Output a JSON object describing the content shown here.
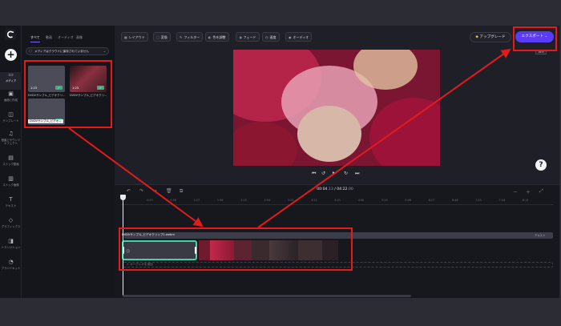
{
  "rail": {
    "items": [
      {
        "label": "メディア",
        "icon": "folder-icon"
      },
      {
        "label": "画面と作成",
        "icon": "camera-icon"
      },
      {
        "label": "テンプレート",
        "icon": "template-icon"
      },
      {
        "label": "音楽とサウンドエフェクト",
        "icon": "music-icon"
      },
      {
        "label": "ストック動画",
        "icon": "film-icon"
      },
      {
        "label": "ストック画像",
        "icon": "image-icon"
      },
      {
        "label": "テキスト",
        "icon": "text-icon"
      },
      {
        "label": "グラフィックス",
        "icon": "shapes-icon"
      },
      {
        "label": "トランジション",
        "icon": "transition-icon"
      },
      {
        "label": "ブランドキット",
        "icon": "brand-icon"
      }
    ]
  },
  "media": {
    "tabs": [
      "すべて",
      "動画",
      "オーディオ",
      "画像"
    ],
    "storage_button": "メディアはクラウドに保存されていません",
    "items": [
      {
        "duration": "1:23",
        "caption": "DVDVサンプル_ビデオクリ..."
      },
      {
        "duration": "1:23",
        "caption": "DVDVサンプル_ビデオクリ..."
      },
      {
        "duration": "1:34",
        "caption": "DVDVサンプル_ビデオ..."
      }
    ]
  },
  "toolbar": {
    "tools": [
      {
        "label": "レイアウト",
        "icon": "layout-icon"
      },
      {
        "label": "変換",
        "icon": "transform-icon"
      },
      {
        "label": "フィルター",
        "icon": "filter-icon"
      },
      {
        "label": "色を調整",
        "icon": "color-icon"
      },
      {
        "label": "フェード",
        "icon": "fade-icon"
      },
      {
        "label": "速度",
        "icon": "speed-icon"
      },
      {
        "label": "オーディオ",
        "icon": "audio-icon"
      }
    ],
    "upgrade": "アップグレード",
    "export": "エクスポート",
    "ratio": "16:9"
  },
  "timeline": {
    "current": "00:04",
    "current_frac": ".13",
    "total": "04:22",
    "total_frac": ".00",
    "ticks": [
      "0:29",
      "0:58",
      "1:27",
      "1:56",
      "2:25",
      "2:54",
      "3:23",
      "3:52",
      "4:21",
      "4:50",
      "5:19",
      "5:48",
      "6:17",
      "6:46",
      "7:15",
      "7:44",
      "8:13"
    ],
    "text_clip": "DVDVサンプル_ビデオクリップ1.webm",
    "text_track_end": "テキスト",
    "audio_placeholder": "+ オーディオを追加"
  },
  "colors": {
    "accent": "#5b3bf5",
    "annotation": "#e31b1b",
    "selection": "#3dd6a8"
  }
}
